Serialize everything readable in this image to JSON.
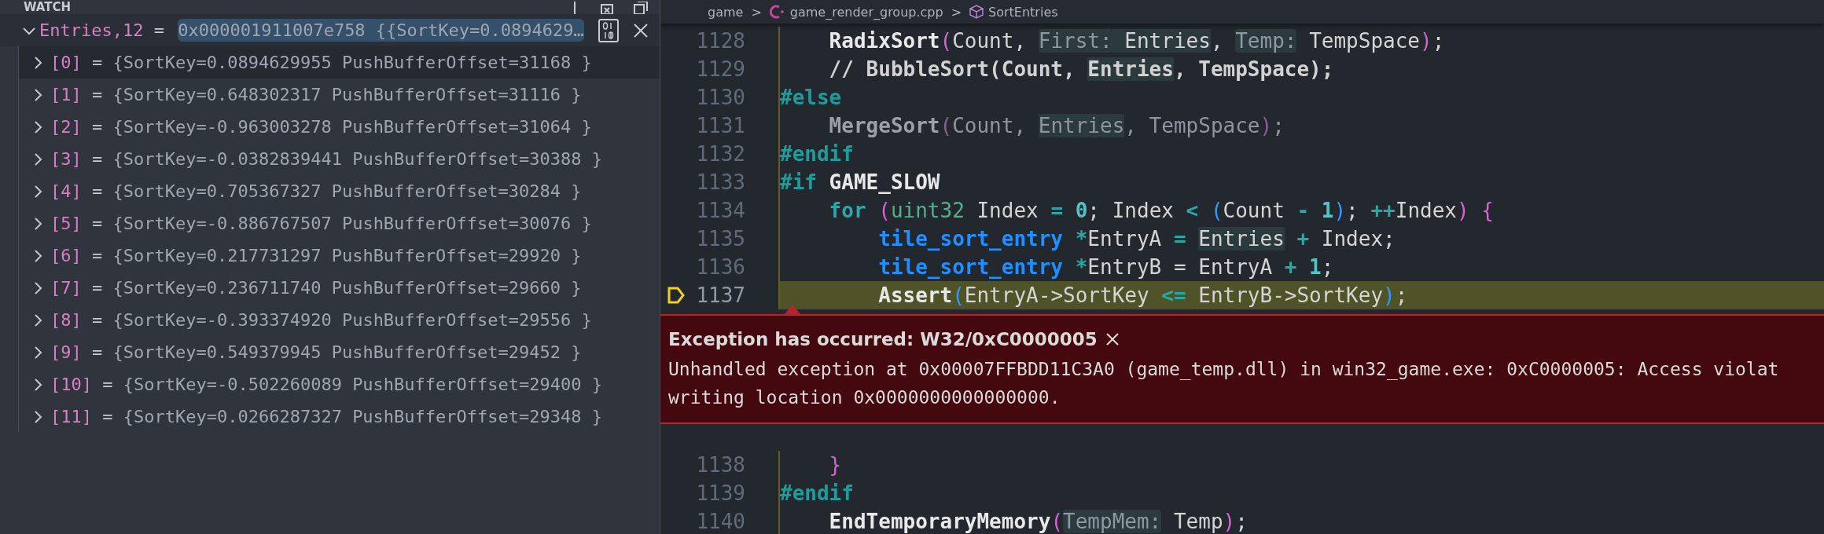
{
  "watch": {
    "title": "WATCH",
    "expression": {
      "name": "Entries,12",
      "op": "=",
      "value": "0x000001911007e758 {{SortKey=0.0894629…",
      "expanded": true,
      "editing": true
    },
    "children": [
      {
        "name": "[0]",
        "op": "=",
        "value": "{SortKey=0.0894629955 PushBufferOffset=31168 }",
        "expanded": false,
        "hovered": true
      },
      {
        "name": "[1]",
        "op": "=",
        "value": "{SortKey=0.648302317 PushBufferOffset=31116 }",
        "expanded": false,
        "hovered": false
      },
      {
        "name": "[2]",
        "op": "=",
        "value": "{SortKey=-0.963003278 PushBufferOffset=31064 }",
        "expanded": false,
        "hovered": false
      },
      {
        "name": "[3]",
        "op": "=",
        "value": "{SortKey=-0.0382839441 PushBufferOffset=30388 }",
        "expanded": false,
        "hovered": false
      },
      {
        "name": "[4]",
        "op": "=",
        "value": "{SortKey=0.705367327 PushBufferOffset=30284 }",
        "expanded": false,
        "hovered": false
      },
      {
        "name": "[5]",
        "op": "=",
        "value": "{SortKey=-0.886767507 PushBufferOffset=30076 }",
        "expanded": false,
        "hovered": false
      },
      {
        "name": "[6]",
        "op": "=",
        "value": "{SortKey=0.217731297 PushBufferOffset=29920 }",
        "expanded": false,
        "hovered": false
      },
      {
        "name": "[7]",
        "op": "=",
        "value": "{SortKey=0.236711740 PushBufferOffset=29660 }",
        "expanded": false,
        "hovered": false
      },
      {
        "name": "[8]",
        "op": "=",
        "value": "{SortKey=-0.393374920 PushBufferOffset=29556 }",
        "expanded": false,
        "hovered": false
      },
      {
        "name": "[9]",
        "op": "=",
        "value": "{SortKey=0.549379945 PushBufferOffset=29452 }",
        "expanded": false,
        "hovered": false
      },
      {
        "name": "[10]",
        "op": "=",
        "value": "{SortKey=-0.502260089 PushBufferOffset=29400 }",
        "expanded": false,
        "hovered": false
      },
      {
        "name": "[11]",
        "op": "=",
        "value": "{SortKey=0.0266287327 PushBufferOffset=29348 }",
        "expanded": false,
        "hovered": false
      }
    ]
  },
  "breadcrumb": [
    {
      "kind": "folder",
      "label": "game"
    },
    {
      "kind": "file",
      "label": "game_render_group.cpp"
    },
    {
      "kind": "symbol",
      "label": "SortEntries"
    }
  ],
  "breadcrumb_separator": ">",
  "editor": {
    "lines_before": [
      {
        "number": "1128",
        "current": false,
        "tokens": [
          {
            "text": "    RadixSort",
            "kind": "fn"
          },
          {
            "text": "(",
            "kind": "p1"
          },
          {
            "text": "Count, ",
            "kind": "plain"
          },
          {
            "text": "First:",
            "kind": "hint"
          },
          {
            "text": " Entries",
            "kind": "ref"
          },
          {
            "text": ", ",
            "kind": "plain"
          },
          {
            "text": "Temp:",
            "kind": "hint"
          },
          {
            "text": " TempSpace",
            "kind": "plain"
          },
          {
            "text": ")",
            "kind": "p1"
          },
          {
            "text": ";",
            "kind": "plain"
          }
        ]
      },
      {
        "number": "1129",
        "current": false,
        "tokens": [
          {
            "text": "    // BubbleSort(Count, ",
            "kind": "comment"
          },
          {
            "text": "Entries",
            "kind": "commentref"
          },
          {
            "text": ", TempSpace);",
            "kind": "comment"
          }
        ]
      },
      {
        "number": "1130",
        "current": false,
        "tokens": [
          {
            "text": "#else",
            "kind": "pre"
          }
        ]
      },
      {
        "number": "1131",
        "current": false,
        "tokens": [
          {
            "text": "    MergeSort",
            "kind": "dimfn"
          },
          {
            "text": "(",
            "kind": "dimp"
          },
          {
            "text": "Count, ",
            "kind": "dim"
          },
          {
            "text": "Entries",
            "kind": "dimref"
          },
          {
            "text": ", TempSpace",
            "kind": "dim"
          },
          {
            "text": ")",
            "kind": "dimp"
          },
          {
            "text": ";",
            "kind": "dim"
          }
        ]
      },
      {
        "number": "1132",
        "current": false,
        "tokens": [
          {
            "text": "#endif",
            "kind": "pre"
          }
        ]
      },
      {
        "number": "1133",
        "current": false,
        "tokens": [
          {
            "text": "#if",
            "kind": "pre"
          },
          {
            "text": " GAME_SLOW",
            "kind": "fn"
          }
        ]
      },
      {
        "number": "1134",
        "current": false,
        "tokens": [
          {
            "text": "    for ",
            "kind": "kw"
          },
          {
            "text": "(",
            "kind": "p1"
          },
          {
            "text": "uint32",
            "kind": "type"
          },
          {
            "text": " Index ",
            "kind": "plain"
          },
          {
            "text": "= ",
            "kind": "op"
          },
          {
            "text": "0",
            "kind": "num"
          },
          {
            "text": "; Index ",
            "kind": "plain"
          },
          {
            "text": "< ",
            "kind": "op"
          },
          {
            "text": "(",
            "kind": "p2"
          },
          {
            "text": "Count ",
            "kind": "plain"
          },
          {
            "text": "- ",
            "kind": "op"
          },
          {
            "text": "1",
            "kind": "num"
          },
          {
            "text": ")",
            "kind": "p2"
          },
          {
            "text": "; ",
            "kind": "plain"
          },
          {
            "text": "++",
            "kind": "op"
          },
          {
            "text": "Index",
            "kind": "plain"
          },
          {
            "text": ") {",
            "kind": "p1"
          }
        ]
      },
      {
        "number": "1135",
        "current": false,
        "tokens": [
          {
            "text": "        tile_sort_entry ",
            "kind": "struct"
          },
          {
            "text": "*",
            "kind": "op"
          },
          {
            "text": "EntryA ",
            "kind": "plain"
          },
          {
            "text": "= ",
            "kind": "op"
          },
          {
            "text": "Entries",
            "kind": "ref"
          },
          {
            "text": " + ",
            "kind": "op"
          },
          {
            "text": "Index;",
            "kind": "plain"
          }
        ]
      },
      {
        "number": "1136",
        "current": false,
        "tokens": [
          {
            "text": "        tile_sort_entry ",
            "kind": "struct"
          },
          {
            "text": "*",
            "kind": "op"
          },
          {
            "text": "EntryB = EntryA ",
            "kind": "plain"
          },
          {
            "text": "+ ",
            "kind": "op"
          },
          {
            "text": "1",
            "kind": "num"
          },
          {
            "text": ";",
            "kind": "plain"
          }
        ]
      },
      {
        "number": "1137",
        "current": true,
        "tokens": [
          {
            "text": "        Assert",
            "kind": "fn"
          },
          {
            "text": "(",
            "kind": "p2"
          },
          {
            "text": "EntryA->SortKey ",
            "kind": "plain"
          },
          {
            "text": "<=",
            "kind": "op"
          },
          {
            "text": " EntryB->SortKey",
            "kind": "plain"
          },
          {
            "text": ")",
            "kind": "p2"
          },
          {
            "text": ";",
            "kind": "plain"
          }
        ]
      }
    ],
    "exception": {
      "title": "Exception has occurred: W32/0xC0000005",
      "message": [
        "Unhandled exception at 0x00007FFBDD11C3A0 (game_temp.dll) in win32_game.exe: 0xC0000005: Access violat",
        "writing location 0x0000000000000000."
      ]
    },
    "lines_after": [
      {
        "number": "1138",
        "current": false,
        "tokens": [
          {
            "text": "    }",
            "kind": "p1"
          }
        ]
      },
      {
        "number": "1139",
        "current": false,
        "tokens": [
          {
            "text": "#endif",
            "kind": "pre"
          }
        ]
      },
      {
        "number": "1140",
        "current": false,
        "tokens": [
          {
            "text": "    EndTemporaryMemory",
            "kind": "fn"
          },
          {
            "text": "(",
            "kind": "p1"
          },
          {
            "text": "TempMem:",
            "kind": "hint"
          },
          {
            "text": " Temp",
            "kind": "plain"
          },
          {
            "text": ")",
            "kind": "p1"
          },
          {
            "text": ";",
            "kind": "plain"
          }
        ]
      }
    ]
  }
}
